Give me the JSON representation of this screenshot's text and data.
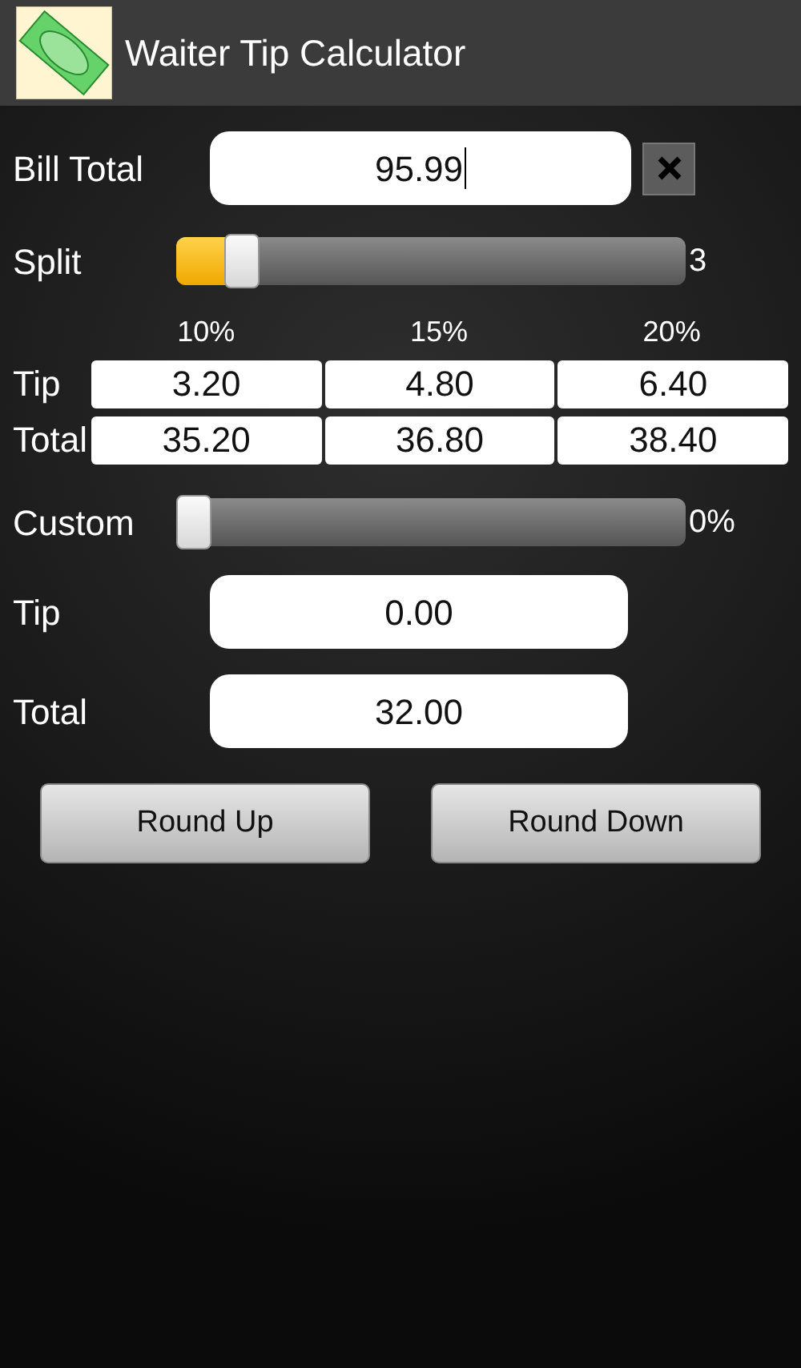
{
  "app_bar": {
    "title": "Waiter Tip Calculator"
  },
  "bill_total": {
    "label": "Bill Total",
    "value": "95.99"
  },
  "split": {
    "label": "Split",
    "level": 0.13,
    "reading": "3"
  },
  "tip_table": {
    "columns": [
      "10%",
      "15%",
      "20%"
    ],
    "rows": [
      {
        "label": "Tip",
        "cells": [
          "3.20",
          "4.80",
          "6.40"
        ]
      },
      {
        "label": "Total",
        "cells": [
          "35.20",
          "36.80",
          "38.40"
        ]
      }
    ]
  },
  "custom": {
    "label": "Custom",
    "level": 0,
    "reading": "0%"
  },
  "tip": {
    "label": "Tip",
    "value": "0.00"
  },
  "total": {
    "label": "Total",
    "value": "32.00"
  },
  "buttons": [
    "Round Up",
    "Round Down"
  ]
}
